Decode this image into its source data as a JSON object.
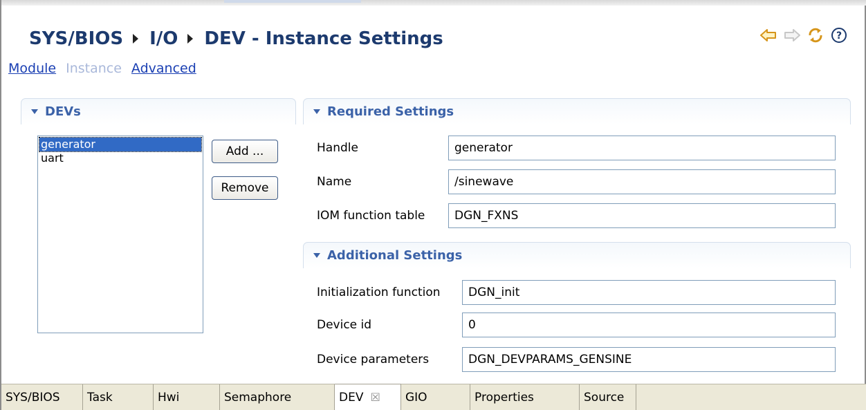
{
  "header": {
    "crumbs": [
      "SYS/BIOS",
      "I/O",
      "DEV - Instance Settings"
    ]
  },
  "toolbar": {
    "icons": [
      "back-arrow-icon",
      "forward-arrow-icon",
      "refresh-icon",
      "help-icon"
    ],
    "accent": "#e3a21a"
  },
  "nav": {
    "module": "Module",
    "instance": "Instance",
    "advanced": "Advanced"
  },
  "devs": {
    "title": "DEVs",
    "items": [
      "generator",
      "uart"
    ],
    "selected": "generator",
    "add_label": "Add ...",
    "remove_label": "Remove"
  },
  "required": {
    "title": "Required Settings",
    "handle_label": "Handle",
    "handle_value": "generator",
    "name_label": "Name",
    "name_value": "/sinewave",
    "iom_label": "IOM function table",
    "iom_value": "DGN_FXNS"
  },
  "additional": {
    "title": "Additional Settings",
    "init_label": "Initialization function",
    "init_value": "DGN_init",
    "devid_label": "Device id",
    "devid_value": "0",
    "params_label": "Device parameters",
    "params_value": "DGN_DEVPARAMS_GENSINE"
  },
  "tabs": [
    "SYS/BIOS",
    "Task",
    "Hwi",
    "Semaphore",
    "DEV",
    "GIO",
    "Properties",
    "Source"
  ],
  "active_tab": "DEV",
  "colors": {
    "title": "#1c3a6e",
    "section": "#3b62a8",
    "link": "#1a3fb3",
    "selection": "#316ac5"
  }
}
